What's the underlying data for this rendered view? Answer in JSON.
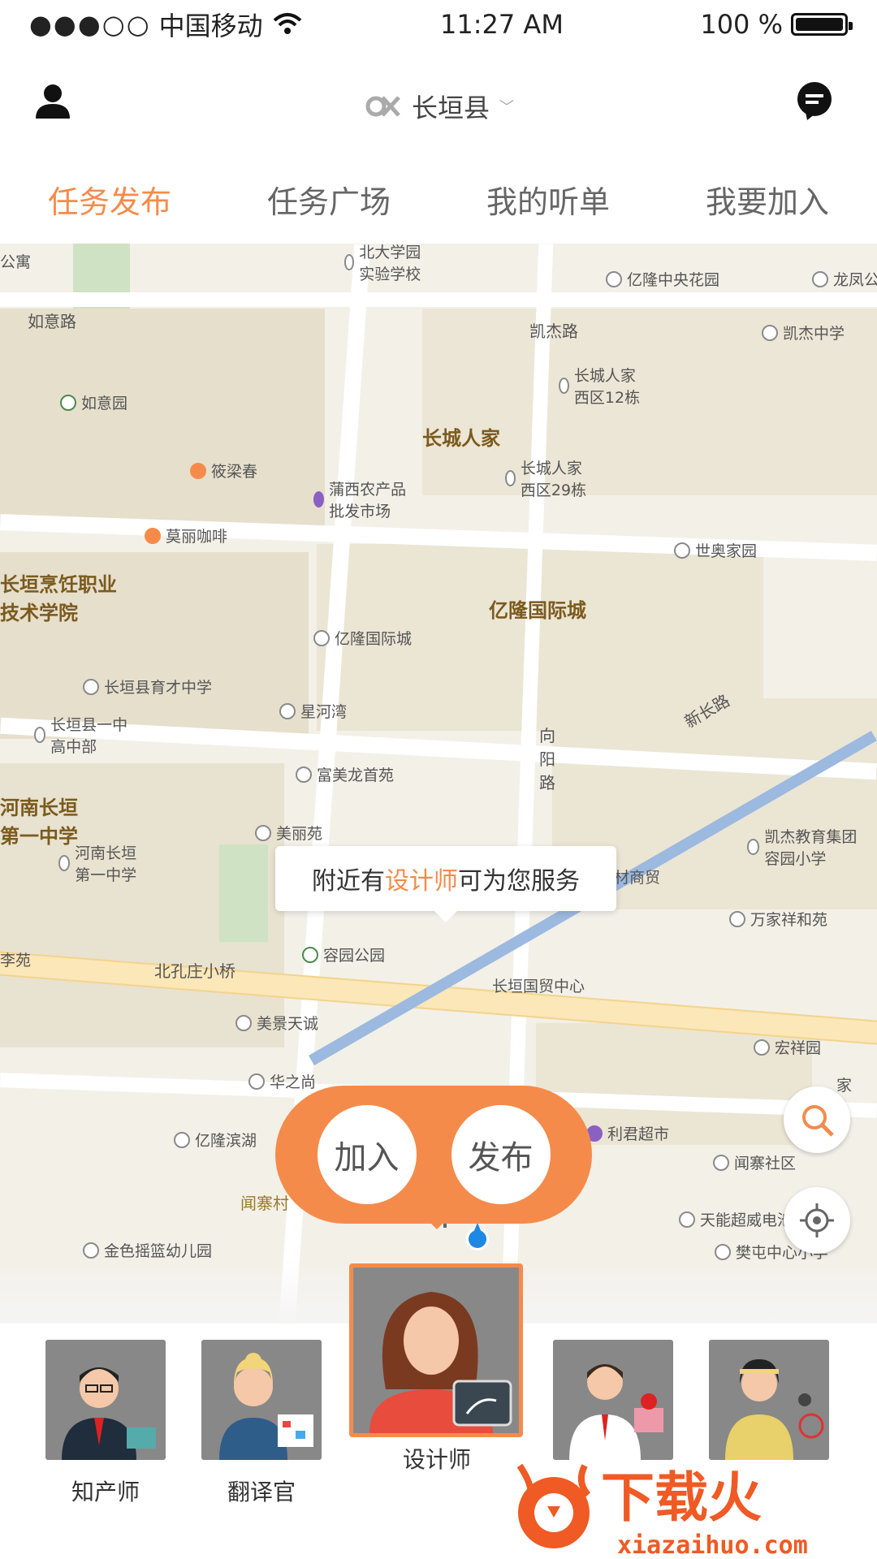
{
  "status": {
    "carrier": "中国移动",
    "time": "11:27 AM",
    "battery": "100 %",
    "battery_level": 1.0
  },
  "header": {
    "city": "长垣县",
    "city_icon": "link-logo-icon",
    "user_icon": "user-icon",
    "message_icon": "message-icon"
  },
  "tabs": [
    {
      "label": "任务发布",
      "active": true
    },
    {
      "label": "任务广场"
    },
    {
      "label": "我的听单"
    },
    {
      "label": "我要加入"
    }
  ],
  "map": {
    "pois": [
      {
        "label": "北大学园 实验学校"
      },
      {
        "label": "亿隆中央花园"
      },
      {
        "label": "龙凤公"
      },
      {
        "label": "凯杰中学"
      },
      {
        "label": "长城人家 西区12栋"
      },
      {
        "label": "长城人家 西区29栋"
      },
      {
        "label": "如意园"
      },
      {
        "label": "筱梁春"
      },
      {
        "label": "蒲西农产品 批发市场"
      },
      {
        "label": "莫丽咖啡"
      },
      {
        "label": "世奥家园"
      },
      {
        "label": "亿隆国际城"
      },
      {
        "label": "长垣县育才中学"
      },
      {
        "label": "星河湾"
      },
      {
        "label": "长垣县一中 高中部"
      },
      {
        "label": "富美龙首苑"
      },
      {
        "label": "美丽苑"
      },
      {
        "label": "河南长垣 第一中学"
      },
      {
        "label": "凯杰教育集团 容园小学"
      },
      {
        "label": "万家祥和苑"
      },
      {
        "label": "容园公园"
      },
      {
        "label": "长垣国贸中心"
      },
      {
        "label": "美景天诚"
      },
      {
        "label": "宏祥园"
      },
      {
        "label": "华之尚"
      },
      {
        "label": "亿隆滨湖"
      },
      {
        "label": "利君超市"
      },
      {
        "label": "闻寨社区"
      },
      {
        "label": "天能超威电池"
      },
      {
        "label": "金色摇篮幼儿园"
      },
      {
        "label": "樊屯中心小学"
      },
      {
        "label": "家"
      },
      {
        "label": "公寓"
      },
      {
        "label": "李苑"
      },
      {
        "label": "材商贸"
      }
    ],
    "areas": [
      "长城人家",
      "亿隆国际城",
      "长垣烹饪职业 技术学院",
      "河南长垣 第一中学"
    ],
    "roads": [
      "如意路",
      "凯杰路",
      "新长路",
      "向阳路",
      "北孔庄小桥",
      "闻寨村"
    ],
    "tooltip": {
      "prefix": "附近有",
      "highlight": "设计师",
      "suffix": "可为您服务"
    },
    "search_icon": "search-icon",
    "locate_icon": "locate-icon"
  },
  "actions": {
    "join": "加入",
    "publish": "发布"
  },
  "professions": [
    {
      "label": "知产师"
    },
    {
      "label": "翻译官"
    },
    {
      "label": "设计师",
      "selected": true
    },
    {
      "label": ""
    },
    {
      "label": ""
    }
  ],
  "watermark": {
    "brand": "下载火",
    "url": "xiazaihuo.com"
  },
  "colors": {
    "accent": "#f58b4b",
    "map_bg": "#f3f0e8",
    "avatar_bg": "#888888"
  }
}
